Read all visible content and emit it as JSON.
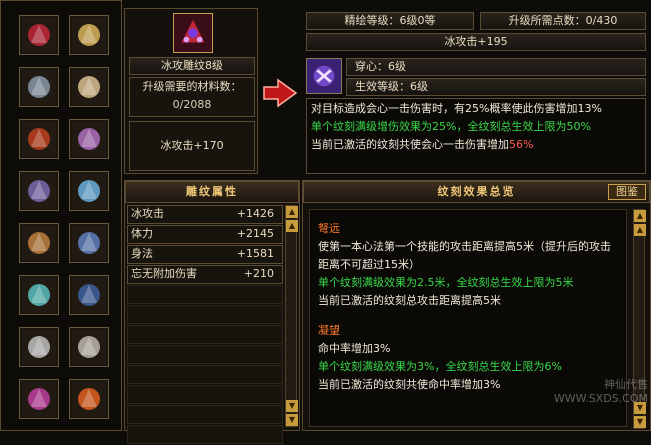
{
  "equipment_slots": [
    {
      "icon": "ruby-necklace-icon",
      "color": "#c0283a"
    },
    {
      "icon": "gold-ring-icon",
      "color": "#d9b45a"
    },
    {
      "icon": "armor-icon",
      "color": "#8a9aa8"
    },
    {
      "icon": "diamond-ring-icon",
      "color": "#d9c090"
    },
    {
      "icon": "belt-icon",
      "color": "#c04020"
    },
    {
      "icon": "bracer-icon",
      "color": "#b070c0"
    },
    {
      "icon": "crown-icon",
      "color": "#7a6ab0"
    },
    {
      "icon": "sword-icon",
      "color": "#6ab0e0"
    },
    {
      "icon": "helmet-icon",
      "color": "#c08040"
    },
    {
      "icon": "gauntlet-icon",
      "color": "#6080c0"
    },
    {
      "icon": "crystal-staff-icon",
      "color": "#5ac0c0"
    },
    {
      "icon": "boots-icon",
      "color": "#4060a0"
    },
    {
      "icon": "jade-pendant-icon",
      "color": "#c0c0c0"
    },
    {
      "icon": "jade-charm-icon",
      "color": "#c0b8b0"
    },
    {
      "icon": "amulet-icon",
      "color": "#c040a0"
    },
    {
      "icon": "fire-orb-icon",
      "color": "#e06020"
    }
  ],
  "engrave": {
    "name": "冰攻雕纹8级",
    "materials_label": "升级需要的材料数：",
    "materials_value": "0/2088",
    "current_bonus": "冰攻击+170"
  },
  "upgrade": {
    "refine_level": "精绘等级：6级0等",
    "points": "升级所需点数：0/430",
    "next_bonus": "冰攻击+195",
    "heart": "穿心：6级",
    "effect_level": "生效等级：6级"
  },
  "description": {
    "line1": "对目标造成会心一击伤害时，有25%概率使此伤害增加13%",
    "line2": "单个纹刻满级增伤效果为25%，全纹刻总生效上限为50%",
    "line3_prefix": "当前已激活的纹刻共使会心一击伤害增加",
    "line3_value": "56%"
  },
  "attributes": {
    "title": "雕纹属性",
    "rows": [
      {
        "name": "冰攻击",
        "value": "+1426"
      },
      {
        "name": "体力",
        "value": "+2145"
      },
      {
        "name": "身法",
        "value": "+1581"
      },
      {
        "name": "忘无附加伤害",
        "value": "+210"
      }
    ]
  },
  "overview": {
    "title": "纹刻效果总览",
    "button": "图鉴",
    "sections": [
      {
        "name": "弩远",
        "desc": "使第一本心法第一个技能的攻击距离提高5米（提升后的攻击距离不可超过15米）",
        "max": "单个纹刻满级效果为2.5米，全纹刻总生效上限为5米",
        "current": "当前已激活的纹刻总攻击距离提高5米"
      },
      {
        "name": "凝望",
        "desc": "命中率增加3%",
        "max": "单个纹刻满级效果为3%，全纹刻总生效上限为6%",
        "current": "当前已激活的纹刻共使命中率增加3%"
      }
    ]
  },
  "watermark": "神仙代售 WWW.SXDS.COM"
}
